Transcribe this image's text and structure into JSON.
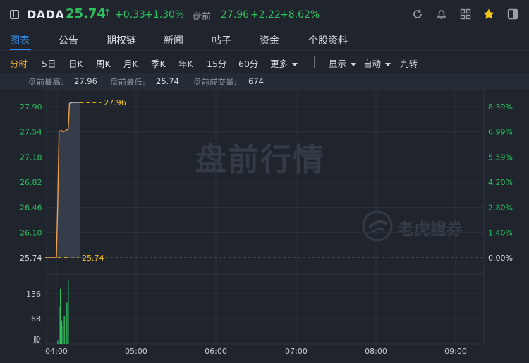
{
  "header": {
    "symbol": "DADA",
    "price": "25.74",
    "price_arrow": "↑",
    "change": "+0.33",
    "change_pct": "+1.30%",
    "premarket_label": "盘前",
    "premarket_price": "27.96",
    "premarket_change": "+2.22",
    "premarket_change_pct": "+8.62%",
    "icons": [
      "refresh-icon",
      "bell-icon",
      "grid-icon",
      "star-icon",
      "sidebar-panel-icon"
    ]
  },
  "tabs": [
    {
      "label": "图表",
      "active": true
    },
    {
      "label": "公告",
      "active": false
    },
    {
      "label": "期权链",
      "active": false
    },
    {
      "label": "新闻",
      "active": false
    },
    {
      "label": "帖子",
      "active": false
    },
    {
      "label": "资金",
      "active": false
    },
    {
      "label": "个股资料",
      "active": false
    }
  ],
  "periods": [
    {
      "label": "分时",
      "active": true
    },
    {
      "label": "5日"
    },
    {
      "label": "日K"
    },
    {
      "label": "周K"
    },
    {
      "label": "月K"
    },
    {
      "label": "季K"
    },
    {
      "label": "年K"
    },
    {
      "label": "15分"
    },
    {
      "label": "60分"
    },
    {
      "label": "更多",
      "dropdown": true
    },
    {
      "label": "显示",
      "dropdown": true
    },
    {
      "label": "自动",
      "dropdown": true
    },
    {
      "label": "九转"
    }
  ],
  "stats": {
    "high_label": "盘前最高:",
    "high_value": "27.96",
    "low_label": "盘前最低:",
    "low_value": "25.74",
    "volume_label": "盘前成交量:",
    "volume_value": "674"
  },
  "watermarks": {
    "main": "盘前行情",
    "brand": "老虎證券"
  },
  "colors": {
    "up": "#2fbf5f",
    "accent": "#2f8cf0",
    "price_line": "#f0a052",
    "marker": "#f5c518",
    "background": "#1f242d"
  },
  "chart_data": {
    "type": "line",
    "price_ticks": [
      "27.90",
      "27.54",
      "27.18",
      "26.82",
      "26.46",
      "26.10",
      "25.74"
    ],
    "pct_ticks": [
      "8.39%",
      "6.99%",
      "5.59%",
      "4.20%",
      "2.80%",
      "1.40%",
      "0.00%"
    ],
    "volume_ticks": [
      "136",
      "68"
    ],
    "volume_unit_label": "股",
    "x_ticks": [
      "04:00",
      "05:00",
      "06:00",
      "07:00",
      "08:00",
      "09:00"
    ],
    "ylim": [
      25.74,
      27.96
    ],
    "reference_price": 25.74,
    "high_marker": "27.96",
    "low_marker": "25.74",
    "price_series": [
      {
        "t": 0,
        "p": 25.74
      },
      {
        "t": 1,
        "p": 26.5
      },
      {
        "t": 2,
        "p": 27.55
      },
      {
        "t": 4,
        "p": 27.56
      },
      {
        "t": 5,
        "p": 27.54
      },
      {
        "t": 9,
        "p": 27.58
      },
      {
        "t": 10,
        "p": 27.95
      },
      {
        "t": 13,
        "p": 27.96
      },
      {
        "t": 18,
        "p": 27.96
      }
    ],
    "volume_series": [
      {
        "t": 1,
        "v": 8
      },
      {
        "t": 2,
        "v": 95
      },
      {
        "t": 3,
        "v": 140
      },
      {
        "t": 4,
        "v": 60
      },
      {
        "t": 5,
        "v": 45
      },
      {
        "t": 6,
        "v": 70
      },
      {
        "t": 8,
        "v": 105
      },
      {
        "t": 9,
        "v": 160
      }
    ],
    "volume_max": 170
  }
}
